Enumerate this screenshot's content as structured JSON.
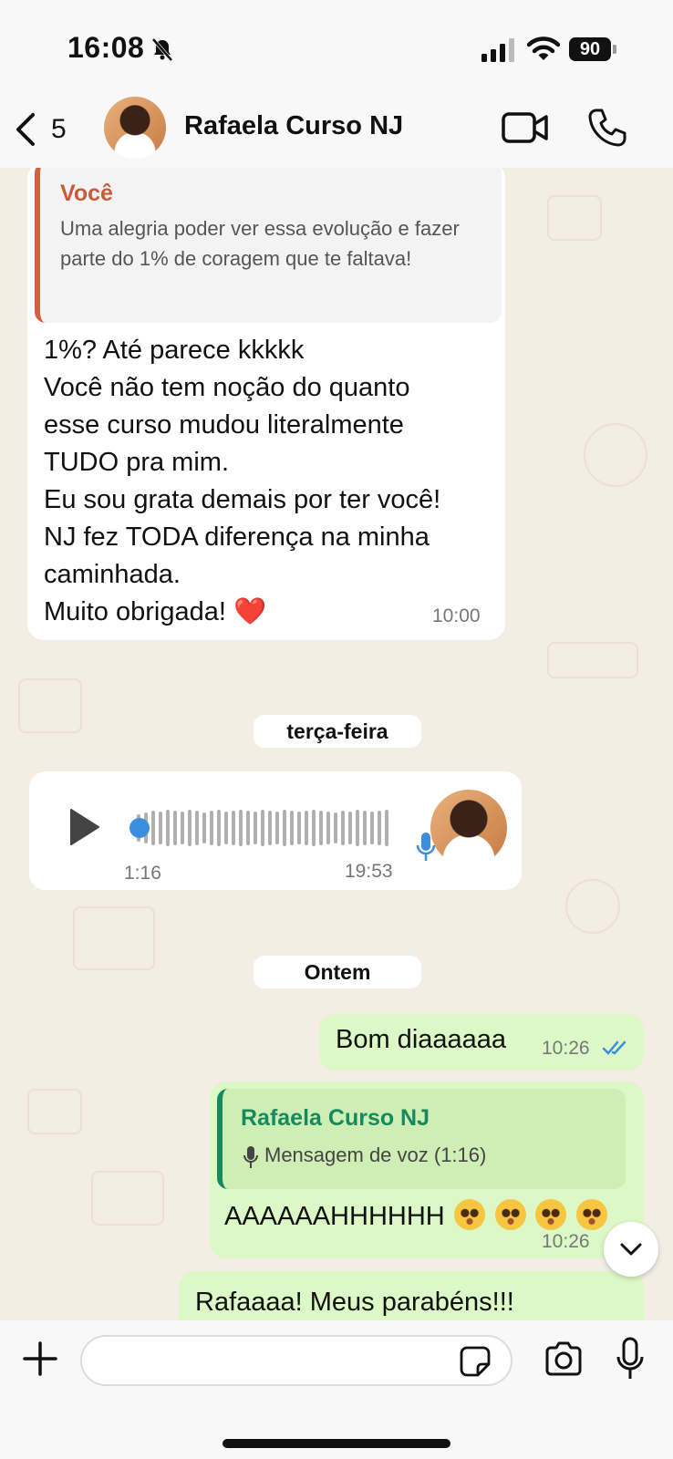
{
  "status_bar": {
    "time": "16:08",
    "battery": "90"
  },
  "header": {
    "back_count": "5",
    "contact_name": "Rafaela Curso NJ"
  },
  "messages": {
    "quoted_message": {
      "author": "Você",
      "text": "Uma alegria poder ver essa evolução e fazer parte do 1% de coragem que te faltava!"
    },
    "reply_message": {
      "lines": [
        "1%? Até parece kkkkk",
        "Você não tem noção do quanto",
        "esse curso mudou literalmente",
        "TUDO pra mim.",
        "Eu sou grata demais por ter você!",
        "NJ fez TODA diferença na minha",
        "caminhada.",
        "Muito obrigada! ❤️"
      ],
      "time": "10:00"
    },
    "date_separator_1": "terça-feira",
    "voice_message": {
      "duration": "1:16",
      "time": "19:53"
    },
    "date_separator_2": "Ontem",
    "outgoing_1": {
      "text": "Bom diaaaaaa",
      "time": "10:26"
    },
    "outgoing_2": {
      "reply_author": "Rafaela Curso NJ",
      "reply_text": "Mensagem de voz (1:16)",
      "text": "AAAAAAHHHHHH",
      "time": "10:26"
    },
    "outgoing_3": {
      "text": "Rafaaaa! Meus parabéns!!!"
    }
  },
  "input": {
    "placeholder": ""
  },
  "colors": {
    "quote_accent": "#d0613e",
    "reply_accent": "#168a5f",
    "outgoing_bubble": "#dcf8c6",
    "read_ticks": "#3b8de0"
  },
  "icons": [
    "mute-icon",
    "signal-icon",
    "wifi-icon",
    "back-chevron-icon",
    "video-call-icon",
    "phone-icon",
    "play-icon",
    "mic-icon",
    "double-check-icon",
    "chevron-down-icon",
    "plus-icon",
    "sticker-icon",
    "camera-icon"
  ]
}
